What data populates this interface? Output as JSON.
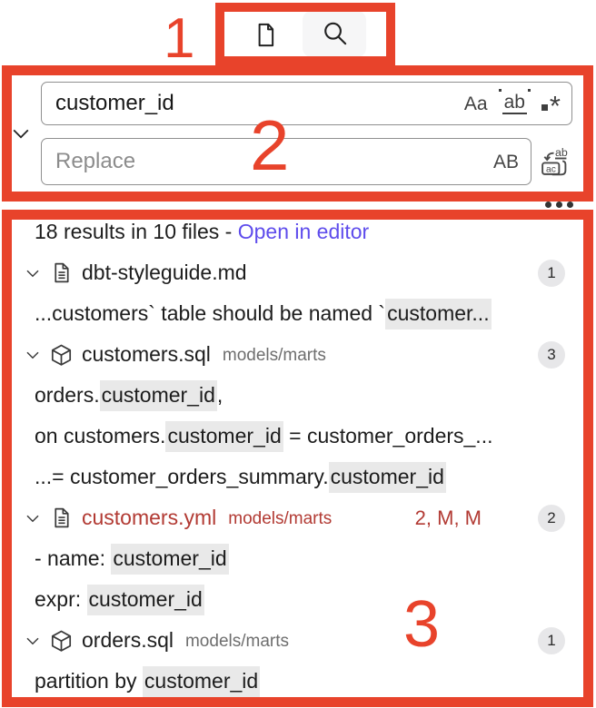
{
  "colors": {
    "annotation_red": "#e8432b",
    "modified_file_red": "#b23a33",
    "match_highlight": "#e9e9e9",
    "link_purple": "#5e4cec",
    "badge_bg": "#e7e7e9"
  },
  "annotations": {
    "label_1": "1",
    "label_2": "2",
    "label_3": "3"
  },
  "view_switcher": {
    "tabs": [
      {
        "icon": "document-icon",
        "active": false
      },
      {
        "icon": "search-icon",
        "active": true
      }
    ]
  },
  "search": {
    "query": "customer_id",
    "match_case_label": "Aa",
    "whole_word_label": "ab",
    "regex_star": "*",
    "replace_placeholder": "Replace",
    "preserve_case_label": "AB"
  },
  "results": {
    "summary": "18 results in 10 files",
    "separator": " - ",
    "open_in_editor_label": "Open in editor",
    "files": [
      {
        "name": "dbt-styleguide.md",
        "icon": "file-icon",
        "path": "",
        "decoration": "",
        "modified": false,
        "count": "1",
        "matches": [
          [
            {
              "text": "...customers` table should be named `"
            },
            {
              "text": "customer...",
              "highlight": true
            }
          ]
        ]
      },
      {
        "name": "customers.sql",
        "icon": "model-cube-icon",
        "path": "models/marts",
        "decoration": "",
        "modified": false,
        "count": "3",
        "matches": [
          [
            {
              "text": "orders."
            },
            {
              "text": "customer_id",
              "highlight": true
            },
            {
              "text": ","
            }
          ],
          [
            {
              "text": "on customers."
            },
            {
              "text": "customer_id",
              "highlight": true
            },
            {
              "text": " = customer_orders_..."
            }
          ],
          [
            {
              "text": "...= customer_orders_summary."
            },
            {
              "text": "customer_id",
              "highlight": true
            }
          ]
        ]
      },
      {
        "name": "customers.yml",
        "icon": "file-icon",
        "path": "models/marts",
        "decoration": "2, M, M",
        "modified": true,
        "count": "2",
        "matches": [
          [
            {
              "text": "- name: "
            },
            {
              "text": "customer_id",
              "highlight": true
            }
          ],
          [
            {
              "text": "expr: "
            },
            {
              "text": "customer_id",
              "highlight": true
            }
          ]
        ]
      },
      {
        "name": "orders.sql",
        "icon": "model-cube-icon",
        "path": "models/marts",
        "decoration": "",
        "modified": false,
        "count": "1",
        "matches": [
          [
            {
              "text": "partition by "
            },
            {
              "text": "customer_id",
              "highlight": true
            }
          ]
        ]
      }
    ]
  }
}
